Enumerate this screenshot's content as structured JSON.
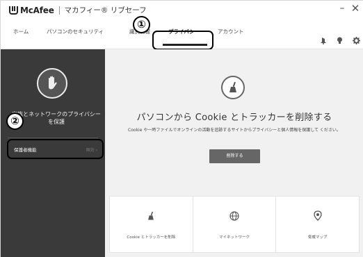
{
  "app": {
    "logo_text": "McAfee",
    "window_title": "マカフィー® リブセーフ"
  },
  "window_controls": {
    "minimize": "–",
    "close": "✕"
  },
  "nav": {
    "tabs": [
      {
        "label": "ホーム",
        "active": false
      },
      {
        "label": "パソコンのセキュリティ",
        "active": false
      },
      {
        "label": "識別情報",
        "active": false
      },
      {
        "label": "プライバシー",
        "active": true
      },
      {
        "label": "アカウント",
        "active": false
      }
    ],
    "icons": [
      "notification-icon",
      "lightbulb-icon",
      "settings-gear-icon"
    ]
  },
  "callouts": {
    "one": "①",
    "two": "②"
  },
  "sidebar": {
    "description": "家族とネットワークのプライバシーを保護",
    "feature_label": "保護者機能",
    "feature_status": "無効"
  },
  "main": {
    "heading": "パソコンから Cookie とトラッカーを削除する",
    "description": "Cookie や一時ファイルでオンラインの活動を追跡するサイトからプライバシーと個人情報を保護して ください。",
    "button_label": "削除する"
  },
  "cards": [
    {
      "label": "Cookie とトラッカーを削除",
      "icon": "broom-icon"
    },
    {
      "label": "マイネットワーク",
      "icon": "globe-icon"
    },
    {
      "label": "脅威マップ",
      "icon": "map-pin-icon"
    }
  ]
}
